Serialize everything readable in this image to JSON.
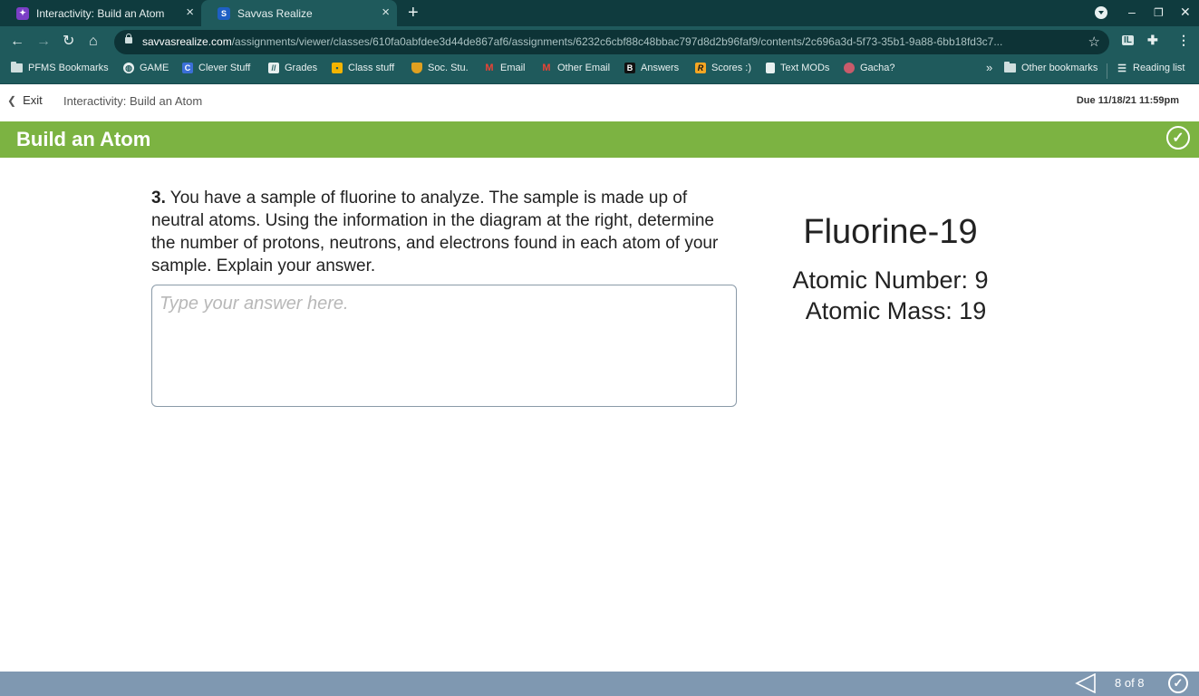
{
  "browser": {
    "tabs": [
      {
        "title": "Interactivity: Build an Atom",
        "active": false
      },
      {
        "title": "Savvas Realize",
        "active": true
      }
    ],
    "url_host": "savvasrealize.com",
    "url_path": "/assignments/viewer/classes/610fa0abfdee3d44de867af6/assignments/6232c6cbf88c48bbac797d8d2b96faf9/contents/2c696a3d-5f73-35b1-9a88-6bb18fd3c7...",
    "extension_label": "IL",
    "bookmarks": [
      {
        "label": "PFMS Bookmarks",
        "icon": "folder-icon"
      },
      {
        "label": "GAME",
        "icon": "globe-icon"
      },
      {
        "label": "Clever Stuff",
        "icon": "clever-icon"
      },
      {
        "label": "Grades",
        "icon": "grades-icon"
      },
      {
        "label": "Class stuff",
        "icon": "classroom-icon"
      },
      {
        "label": "Soc. Stu.",
        "icon": "shield-icon"
      },
      {
        "label": "Email",
        "icon": "gmail-icon"
      },
      {
        "label": "Other Email",
        "icon": "gmail-icon"
      },
      {
        "label": "Answers",
        "icon": "brainly-icon"
      },
      {
        "label": "Scores :)",
        "icon": "r-icon"
      },
      {
        "label": "Text MODs",
        "icon": "doc-icon"
      },
      {
        "label": "Gacha?",
        "icon": "gacha-icon"
      }
    ],
    "overflow_label": "»",
    "other_bookmarks": "Other bookmarks",
    "reading_list": "Reading list"
  },
  "header": {
    "exit_label": "Exit",
    "assignment_title": "Interactivity: Build an Atom",
    "due": "Due 11/18/21 11:59pm"
  },
  "banner": {
    "title": "Build an Atom",
    "color": "#7cb342"
  },
  "question": {
    "number": "3.",
    "text": "You have a sample of fluorine to analyze. The sample is made up of neutral atoms. Using the information in the diagram at the right, determine the number of protons, neutrons, and electrons found in each atom of your sample. Explain your answer.",
    "answer_placeholder": "Type your answer here.",
    "answer_value": ""
  },
  "diagram": {
    "element": "Fluorine-19",
    "atomic_number": "Atomic Number: 9",
    "atomic_mass": "Atomic Mass: 19"
  },
  "footer": {
    "page_indicator": "8 of 8",
    "color": "#7f98b1"
  }
}
